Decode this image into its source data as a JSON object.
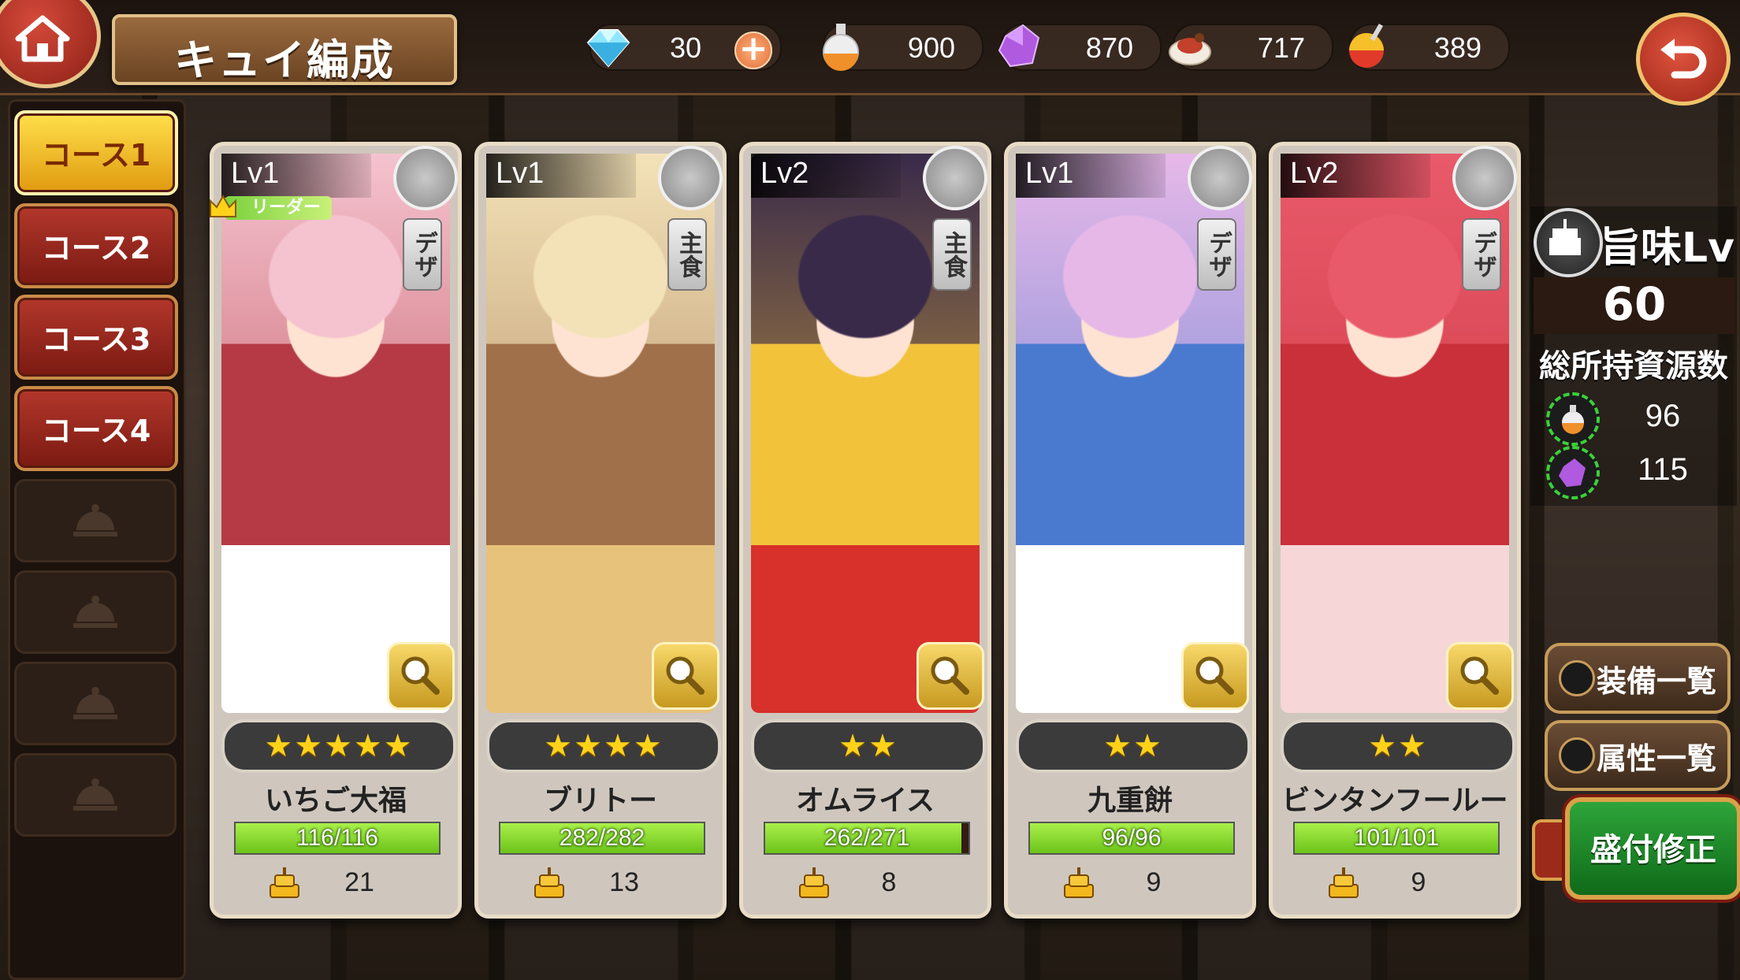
{
  "header": {
    "title": "キュイ編成",
    "gems": "30",
    "potion": "900",
    "crystal": "870",
    "meat": "717",
    "dish": "389"
  },
  "courses": {
    "items": [
      "コース1",
      "コース2",
      "コース3",
      "コース4"
    ],
    "active_index": 0,
    "locked_slots": 4
  },
  "cards": [
    {
      "lv": "Lv1",
      "type": "デザ",
      "leader": "リーダー",
      "stars": 5,
      "stars_text": "★★★★★",
      "name": "いちご大福",
      "hp": "116/116",
      "hp_fraction": 1.0,
      "dish": "21",
      "art": [
        "#f4c3cf",
        "#b53a45",
        "#ffffff"
      ]
    },
    {
      "lv": "Lv1",
      "type": "主食",
      "leader": "",
      "stars": 4,
      "stars_text": "★★★★",
      "name": "ブリトー",
      "hp": "282/282",
      "hp_fraction": 1.0,
      "dish": "13",
      "art": [
        "#f3e2b8",
        "#a0704a",
        "#e7c27a"
      ]
    },
    {
      "lv": "Lv2",
      "type": "主食",
      "leader": "",
      "stars": 2,
      "stars_text": "★★",
      "name": "オムライス",
      "hp": "262/271",
      "hp_fraction": 0.967,
      "dish": "8",
      "art": [
        "#3a2a4a",
        "#f2c23a",
        "#d8302a"
      ]
    },
    {
      "lv": "Lv1",
      "type": "デザ",
      "leader": "",
      "stars": 2,
      "stars_text": "★★",
      "name": "九重餅",
      "hp": "96/96",
      "hp_fraction": 1.0,
      "dish": "9",
      "art": [
        "#e6b8e8",
        "#4a7ad0",
        "#ffffff"
      ]
    },
    {
      "lv": "Lv2",
      "type": "デザ",
      "leader": "",
      "stars": 2,
      "stars_text": "★★",
      "name": "ビンタンフールー",
      "hp": "101/101",
      "hp_fraction": 1.0,
      "dish": "9",
      "art": [
        "#e85a6a",
        "#c9303a",
        "#f6d6d6"
      ]
    }
  ],
  "right": {
    "umami_label": "旨味Lv",
    "umami_value": "60",
    "holdings_label": "総所持資源数",
    "potion_count": "96",
    "crystal_count": "115",
    "equip_list": "装備一覧",
    "attr_list": "属性一覧",
    "serve_fix": "盛付修正"
  }
}
